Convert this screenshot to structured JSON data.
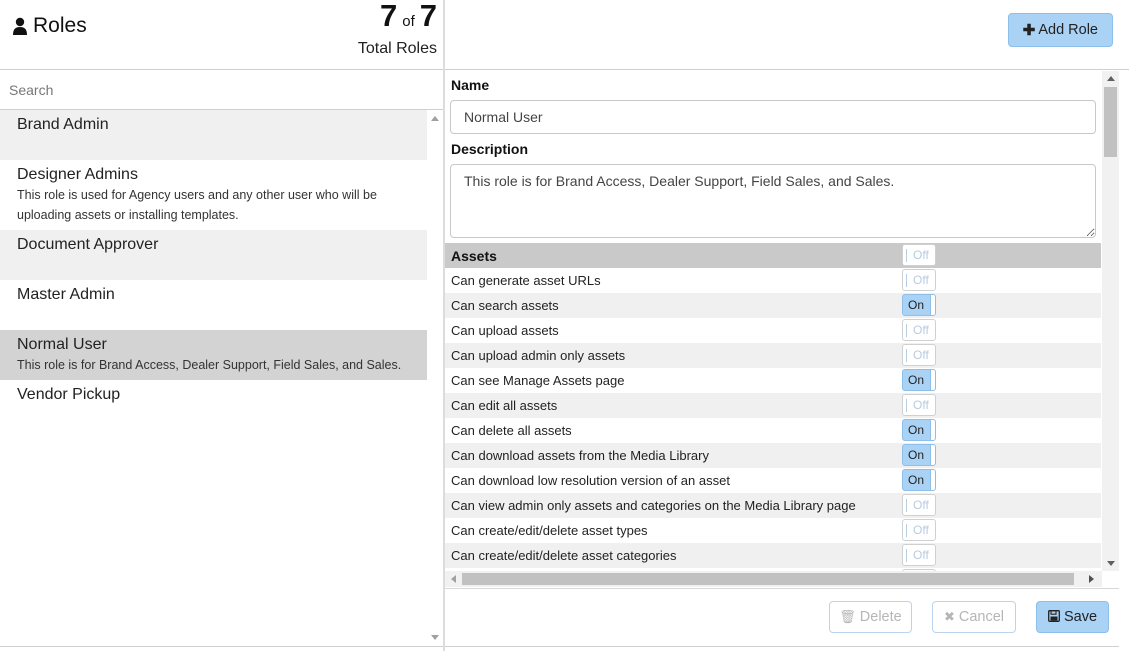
{
  "header": {
    "title": "Roles",
    "count_current": "7",
    "count_of": "of",
    "count_total": "7",
    "count_label": "Total Roles"
  },
  "search": {
    "placeholder": "Search",
    "value": ""
  },
  "roles": [
    {
      "name": "Brand Admin",
      "description": ""
    },
    {
      "name": "Designer Admins",
      "description": "This role is used for Agency users and any other user who will be uploading assets or installing templates."
    },
    {
      "name": "Document Approver",
      "description": ""
    },
    {
      "name": "Master Admin",
      "description": ""
    },
    {
      "name": "Normal User",
      "description": "This role is for Brand Access, Dealer Support, Field Sales, and Sales."
    },
    {
      "name": "Vendor Pickup",
      "description": ""
    }
  ],
  "selected_role": "Normal User",
  "toolbar": {
    "add_role_label": "Add Role"
  },
  "form": {
    "name_label": "Name",
    "name_value": "Normal User",
    "description_label": "Description",
    "description_value": "This role is for Brand Access, Dealer Support, Field Sales, and Sales."
  },
  "permissions": [
    {
      "label": "Assets",
      "state": "Off",
      "header": true
    },
    {
      "label": "Can generate asset URLs",
      "state": "Off"
    },
    {
      "label": "Can search assets",
      "state": "On"
    },
    {
      "label": "Can upload assets",
      "state": "Off"
    },
    {
      "label": "Can upload admin only assets",
      "state": "Off"
    },
    {
      "label": "Can see Manage Assets page",
      "state": "On"
    },
    {
      "label": "Can edit all assets",
      "state": "Off"
    },
    {
      "label": "Can delete all assets",
      "state": "On"
    },
    {
      "label": "Can download assets from the Media Library",
      "state": "On"
    },
    {
      "label": "Can download low resolution version of an asset",
      "state": "On"
    },
    {
      "label": "Can view admin only assets and categories on the Media Library page",
      "state": "Off"
    },
    {
      "label": "Can create/edit/delete asset types",
      "state": "Off"
    },
    {
      "label": "Can create/edit/delete asset categories",
      "state": "Off"
    },
    {
      "label": "",
      "state": "Off"
    }
  ],
  "footer": {
    "delete_label": "Delete",
    "cancel_label": "Cancel",
    "save_label": "Save"
  },
  "colors": {
    "accent": "#a9d2f5",
    "accent_border": "#8cbfe9",
    "selected_row": "#d3d3d3",
    "alt_row": "#f0f0f0",
    "section_header": "#c9c9c9"
  },
  "icons": {
    "title": "user-icon",
    "add": "plus-icon",
    "delete": "trash-icon",
    "cancel": "close-icon",
    "save": "floppy-disk-icon"
  }
}
